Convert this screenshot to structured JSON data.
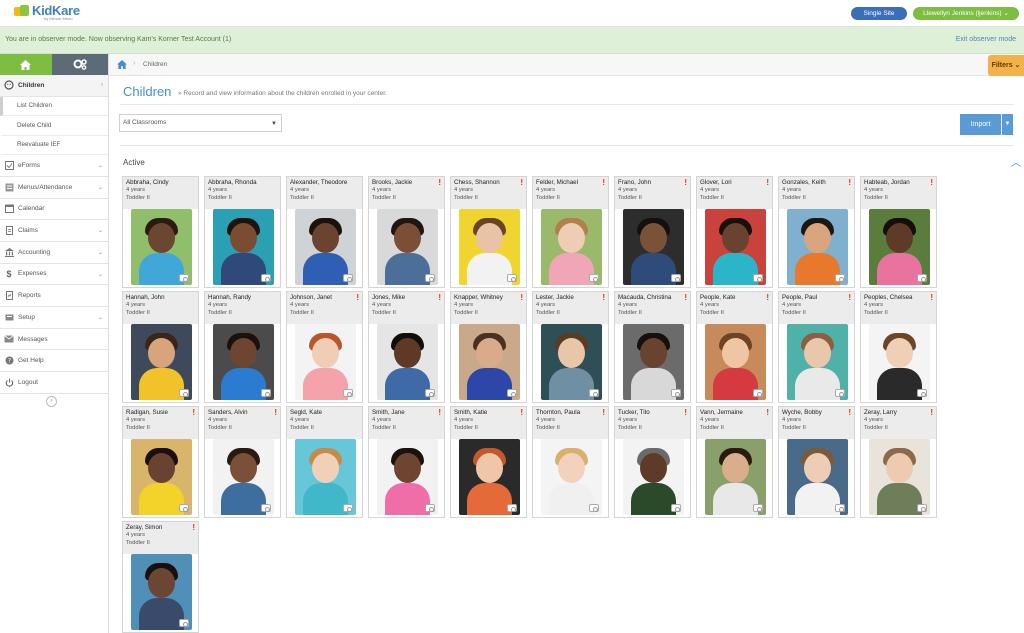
{
  "header": {
    "logo_text": "KidKare",
    "logo_sub": "by Minute Menu",
    "site_button": "Single Site",
    "user_button": "Llewellyn Jenkins (ljenkins) ⌄"
  },
  "observer": {
    "message": "You are in observer mode. Now observing Kam's Korner Test Account (1)",
    "exit": "Exit observer mode"
  },
  "sidebar": {
    "items": [
      {
        "label": "Children",
        "icon": "child-icon",
        "active": true,
        "chevron": "›"
      },
      {
        "label": "eForms",
        "icon": "checklist-icon",
        "chevron": "⌄"
      },
      {
        "label": "Menus/Attendance",
        "icon": "menu-icon",
        "chevron": "⌄"
      },
      {
        "label": "Calendar",
        "icon": "calendar-icon",
        "chevron": ""
      },
      {
        "label": "Claims",
        "icon": "document-icon",
        "chevron": "⌄"
      },
      {
        "label": "Accounting",
        "icon": "bank-icon",
        "chevron": "⌄"
      },
      {
        "label": "Expenses",
        "icon": "dollar-icon",
        "chevron": "⌄"
      },
      {
        "label": "Reports",
        "icon": "report-icon",
        "chevron": ""
      },
      {
        "label": "Setup",
        "icon": "setup-icon",
        "chevron": "⌄"
      },
      {
        "label": "Messages",
        "icon": "envelope-icon",
        "chevron": ""
      },
      {
        "label": "Get Help",
        "icon": "help-icon",
        "chevron": ""
      },
      {
        "label": "Logout",
        "icon": "power-icon",
        "chevron": ""
      }
    ],
    "subitems": [
      "List Children",
      "Delete Child",
      "Reevaluate IEF"
    ]
  },
  "breadcrumb": {
    "current": "Children",
    "separator": "›"
  },
  "filters": "Filters ⌄",
  "page": {
    "title": "Children",
    "description": "» Record and view information about the children enrolled in your center.",
    "classroom_select": "All Classrooms",
    "import": "Import",
    "section": "Active"
  },
  "children": [
    {
      "name": "Abbraha, Cindy",
      "age": "4 years",
      "room": "Toddler II",
      "alert": false,
      "bg": "#8fbf6a",
      "skin": "#6b4630",
      "shirt": "#3fa8d8",
      "hair": "#2a1a10"
    },
    {
      "name": "Abbraha, Rhonda",
      "age": "4 years",
      "room": "Toddler II",
      "alert": false,
      "bg": "#2b9fb3",
      "skin": "#7a4d33",
      "shirt": "#2f4a7a",
      "hair": "#1e140e"
    },
    {
      "name": "Alexander, Theodore",
      "age": "4 years",
      "room": "Toddler II",
      "alert": false,
      "bg": "#cfd3d6",
      "skin": "#6a4430",
      "shirt": "#2f5fb5",
      "hair": "#1b120c"
    },
    {
      "name": "Brooks, Jackie",
      "age": "4 years",
      "room": "Toddler II",
      "alert": true,
      "bg": "#d9d9d9",
      "skin": "#7b4f36",
      "shirt": "#4c6f9a",
      "hair": "#201510"
    },
    {
      "name": "Chess, Shannon",
      "age": "4 years",
      "room": "Toddler II",
      "alert": true,
      "bg": "#f0d531",
      "skin": "#e8c3a5",
      "shirt": "#f2f2f2",
      "hair": "#6b4423"
    },
    {
      "name": "Felder, Michael",
      "age": "4 years",
      "room": "Toddler II",
      "alert": true,
      "bg": "#9ab96a",
      "skin": "#efcdb5",
      "shirt": "#f1a6b8",
      "hair": "#b08050"
    },
    {
      "name": "Frano, John",
      "age": "4 years",
      "room": "Toddler II",
      "alert": true,
      "bg": "#2d2d2d",
      "skin": "#7a5238",
      "shirt": "#2e4b7a",
      "hair": "#151010"
    },
    {
      "name": "Glover, Lori",
      "age": "4 years",
      "room": "Toddler II",
      "alert": true,
      "bg": "#c9433c",
      "skin": "#6a4330",
      "shirt": "#2bb5c9",
      "hair": "#1a100b"
    },
    {
      "name": "Gonzales, Keith",
      "age": "4 years",
      "room": "Toddler II",
      "alert": true,
      "bg": "#7fb1cf",
      "skin": "#d9a57e",
      "shirt": "#e8782b",
      "hair": "#1e1610"
    },
    {
      "name": "Habteab, Jordan",
      "age": "4 years",
      "room": "Toddler II",
      "alert": true,
      "bg": "#5a7d3d",
      "skin": "#5e3b27",
      "shirt": "#e9739e",
      "hair": "#160e09"
    },
    {
      "name": "Hannah, John",
      "age": "4 years",
      "room": "Toddler II",
      "alert": false,
      "bg": "#3e4a5c",
      "skin": "#d8a47c",
      "shirt": "#f2c22b",
      "hair": "#3a2618"
    },
    {
      "name": "Hannah, Randy",
      "age": "4 years",
      "room": "Toddler II",
      "alert": false,
      "bg": "#4b4b4b",
      "skin": "#6d4530",
      "shirt": "#2b7bd1",
      "hair": "#1a110b"
    },
    {
      "name": "Johnson, Janet",
      "age": "4 years",
      "room": "Toddler II",
      "alert": true,
      "bg": "#f3f3f3",
      "skin": "#f0cdb4",
      "shirt": "#f3a3a9",
      "hair": "#b7582c"
    },
    {
      "name": "Jones, Mike",
      "age": "4 years",
      "room": "Toddler II",
      "alert": true,
      "bg": "#e5e5e5",
      "skin": "#5e3a26",
      "shirt": "#3e6aa8",
      "hair": "#120c08"
    },
    {
      "name": "Knapper, Whitney",
      "age": "4 years",
      "room": "Toddler II",
      "alert": true,
      "bg": "#c9a98a",
      "skin": "#d9ab8a",
      "shirt": "#2c47a8",
      "hair": "#4a3020"
    },
    {
      "name": "Lester, Jackie",
      "age": "4 years",
      "room": "Toddler II",
      "alert": true,
      "bg": "#2f4f56",
      "skin": "#e9c6a8",
      "shirt": "#6f8fa4",
      "hair": "#5a3c22"
    },
    {
      "name": "Macauda, Christina",
      "age": "4 years",
      "room": "Toddler II",
      "alert": true,
      "bg": "#6b6b6b",
      "skin": "#6a4230",
      "shirt": "#d8d8d8",
      "hair": "#160f0a"
    },
    {
      "name": "People, Kate",
      "age": "4 years",
      "room": "Toddler II",
      "alert": true,
      "bg": "#c78a5a",
      "skin": "#efc6a4",
      "shirt": "#d43a3f",
      "hair": "#6e4425"
    },
    {
      "name": "People, Paul",
      "age": "4 years",
      "room": "Toddler II",
      "alert": true,
      "bg": "#4fb1a8",
      "skin": "#eac7aa",
      "shirt": "#e9e9e9",
      "hair": "#8a6040"
    },
    {
      "name": "Peoples, Chelsea",
      "age": "4 years",
      "room": "Toddler II",
      "alert": true,
      "bg": "#f4f4f4",
      "skin": "#efcfb6",
      "shirt": "#2a2a2a",
      "hair": "#6a4528"
    },
    {
      "name": "Radigan, Susie",
      "age": "4 years",
      "room": "Toddler II",
      "alert": true,
      "bg": "#d9b56b",
      "skin": "#6a4230",
      "shirt": "#f3d32a",
      "hair": "#1a100b"
    },
    {
      "name": "Sanders, Alvin",
      "age": "4 years",
      "room": "Toddler II",
      "alert": true,
      "bg": "#f2f2f2",
      "skin": "#7a5038",
      "shirt": "#3e6ea0",
      "hair": "#2a1a12"
    },
    {
      "name": "Segld, Kate",
      "age": "4 years",
      "room": "Toddler II",
      "alert": false,
      "bg": "#67c7d8",
      "skin": "#f0d0b8",
      "shirt": "#40b8c9",
      "hair": "#c58b4a"
    },
    {
      "name": "Smith, Jane",
      "age": "4 years",
      "room": "Toddler II",
      "alert": true,
      "bg": "#f2f2f2",
      "skin": "#6e4530",
      "shirt": "#f06ea8",
      "hair": "#1c120c"
    },
    {
      "name": "Smith, Katie",
      "age": "4 years",
      "room": "Toddler II",
      "alert": true,
      "bg": "#2a2a2a",
      "skin": "#f0c6a8",
      "shirt": "#e56a3a",
      "hair": "#c2592c"
    },
    {
      "name": "Thornton, Paula",
      "age": "4 years",
      "room": "Toddler II",
      "alert": true,
      "bg": "#f4f4f4",
      "skin": "#f2d2bc",
      "shirt": "#f0f0f0",
      "hair": "#d8b070"
    },
    {
      "name": "Tucker, Tito",
      "age": "4 years",
      "room": "Toddler II",
      "alert": true,
      "bg": "#f3f3f3",
      "skin": "#5e3b28",
      "shirt": "#2b4a2a",
      "hair": "#6a6a6a"
    },
    {
      "name": "Vann, Jermaine",
      "age": "4 years",
      "room": "Toddler II",
      "alert": true,
      "bg": "#8aa06a",
      "skin": "#d8ae8c",
      "shirt": "#e8e8e8",
      "hair": "#2a1a10"
    },
    {
      "name": "Wyche, Bobby",
      "age": "4 years",
      "room": "Toddler II",
      "alert": true,
      "bg": "#4a6a8a",
      "skin": "#edcdb4",
      "shirt": "#f2f2f2",
      "hair": "#7a5a3a"
    },
    {
      "name": "Zeray, Larry",
      "age": "4 years",
      "room": "Toddler II",
      "alert": true,
      "bg": "#e8e4dc",
      "skin": "#eecbb0",
      "shirt": "#6e7e5a",
      "hair": "#8a6a48"
    },
    {
      "name": "Zeray, Simon",
      "age": "4 years",
      "room": "Toddler II",
      "alert": true,
      "bg": "#4f8fb8",
      "skin": "#6a4634",
      "shirt": "#3a4a6a",
      "hair": "#1a100b"
    }
  ],
  "colors": {
    "brand_green": "#7cbd42",
    "brand_blue": "#3c6db8",
    "alert_red": "#d9352b",
    "title_blue": "#4a8cc9"
  }
}
